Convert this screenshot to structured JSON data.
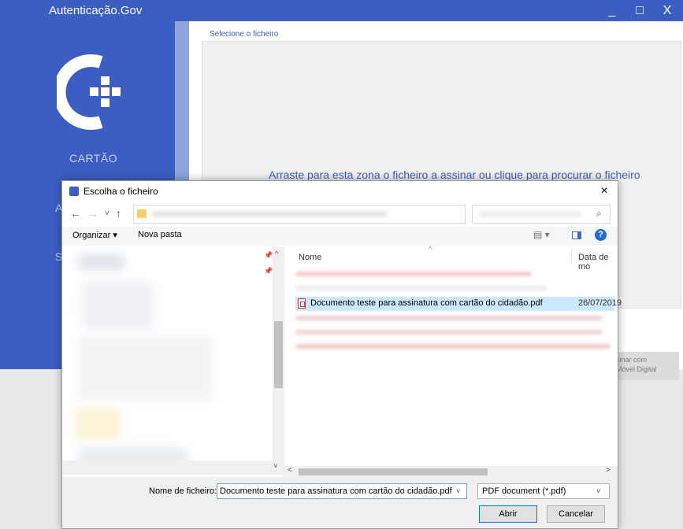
{
  "app": {
    "title": "Autenticação.Gov",
    "window_controls": {
      "minimize": "_",
      "maximize": "□",
      "close": "X"
    },
    "sidebar": {
      "items": [
        {
          "label": "CARTÃO"
        },
        {
          "label": "A"
        },
        {
          "label": "S"
        }
      ]
    },
    "content": {
      "section_label": "Selecione o ficheiro",
      "dropzone_text": "Arraste para esta zona o ficheiro a assinar ou clique para procurar o ficheiro",
      "cmd_button_line1": "sinar com",
      "cmd_button_line2": "Móvel Digital"
    }
  },
  "dialog": {
    "title": "Escolha o ficheiro",
    "close_glyph": "×",
    "nav": {
      "back": "←",
      "forward": "→",
      "recent": "˅",
      "up": "↑",
      "address_dropdown": "˅",
      "refresh": "↻",
      "search_glyph": "⌕"
    },
    "toolbar": {
      "organize": "Organizar ▾",
      "new_folder": "Nova pasta",
      "view_glyph": "▤ ▾",
      "help": "?"
    },
    "columns": {
      "name": "Nome",
      "date": "Data de mo",
      "sort_glyph": "^"
    },
    "files": [
      {
        "name": "Documento teste para assinatura com cartão do cidadão.pdf",
        "date": "26/07/2019",
        "selected": true
      }
    ],
    "footer": {
      "filename_label": "Nome de ficheiro:",
      "filename_value": "Documento teste para assinatura com cartão do cidadão.pdf",
      "filter_value": "PDF document (*.pdf)",
      "dropdown_glyph": "˅",
      "open": "Abrir",
      "cancel": "Cancelar"
    },
    "scroll": {
      "left": "<",
      "right": ">",
      "up": "^",
      "down": "˅"
    },
    "pin_glyph": "📌"
  },
  "colors": {
    "brand_blue": "#3c5dc2",
    "selection": "#cce8ff"
  }
}
